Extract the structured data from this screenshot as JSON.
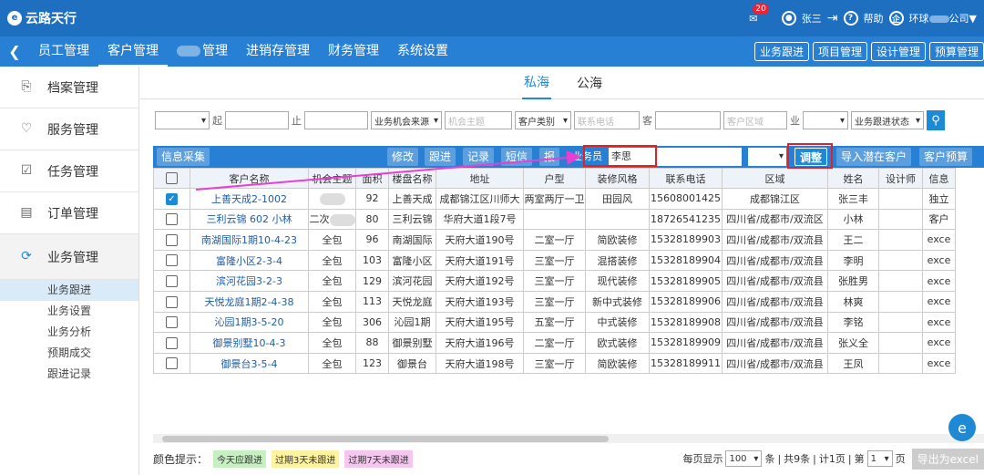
{
  "app": {
    "logo": "云路天行"
  },
  "topbar": {
    "badge_count": "20",
    "user": "张三",
    "help": "帮助",
    "company": "环球",
    "company_suffix": "公司▼"
  },
  "nav": {
    "items": [
      "员工管理",
      "客户管理",
      "管理",
      "进销存管理",
      "财务管理",
      "系统设置"
    ],
    "right_buttons": [
      "业务跟进",
      "项目管理",
      "设计管理",
      "预算管理"
    ]
  },
  "sidebar": {
    "items": [
      "档案管理",
      "服务管理",
      "任务管理",
      "订单管理",
      "业务管理"
    ],
    "sub_items": [
      "业务跟进",
      "业务设置",
      "业务分析",
      "预期成交",
      "跟进记录"
    ]
  },
  "tabs": [
    "私海",
    "公海"
  ],
  "filter": {
    "from": "起",
    "to": "止",
    "source": "业务机会来源",
    "topic_ph": "机会主题",
    "cust_type": "客户类别",
    "phone_ph": "联系电话",
    "cust": "客",
    "region_ph": "客户区域",
    "industry": "业",
    "status": "业务跟进状态"
  },
  "actions": {
    "collect": "信息采集",
    "edit": "修改",
    "follow": "跟进",
    "record": "记录",
    "sms": "短信",
    "report": "报",
    "staff_label": "业务员",
    "staff_value": "李思",
    "adjust": "调整",
    "import": "导入潜在客户",
    "budget": "客户预算"
  },
  "table": {
    "headers": [
      "客户名称",
      "机会主题",
      "面积",
      "楼盘名称",
      "地址",
      "户型",
      "装修风格",
      "联系电话",
      "区域",
      "姓名",
      "设计师",
      "信息"
    ],
    "rows": [
      [
        "上善天成2-1002",
        "",
        "92",
        "上善天成",
        "成都锦江区川师大",
        "两室两厅一卫",
        "田园风",
        "15608001425",
        "成都锦江区",
        "张三丰",
        "",
        "独立"
      ],
      [
        "三利云锦 602 小林",
        "二次",
        "80",
        "三利云锦",
        "华府大道1段7号",
        "",
        "",
        "18726541235",
        "四川省/成都市/双流区",
        "小林",
        "",
        "客户"
      ],
      [
        "南湖国际1期10-4-23",
        "全包",
        "96",
        "南湖国际",
        "天府大道190号",
        "二室一厅",
        "简欧装修",
        "15328189903",
        "四川省/成都市/双流县",
        "王二",
        "",
        "exce"
      ],
      [
        "富隆小区2-3-4",
        "全包",
        "103",
        "富隆小区",
        "天府大道191号",
        "三室一厅",
        "混搭装修",
        "15328189904",
        "四川省/成都市/双流县",
        "李明",
        "",
        "exce"
      ],
      [
        "滨河花园3-2-3",
        "全包",
        "129",
        "滨河花园",
        "天府大道192号",
        "三室一厅",
        "现代装修",
        "15328189905",
        "四川省/成都市/双流县",
        "张胜男",
        "",
        "exce"
      ],
      [
        "天悦龙庭1期2-4-38",
        "全包",
        "113",
        "天悦龙庭",
        "天府大道193号",
        "三室一厅",
        "新中式装修",
        "15328189906",
        "四川省/成都市/双流县",
        "林爽",
        "",
        "exce"
      ],
      [
        "沁园1期3-5-20",
        "全包",
        "306",
        "沁园1期",
        "天府大道195号",
        "五室一厅",
        "中式装修",
        "15328189908",
        "四川省/成都市/双流县",
        "李铭",
        "",
        "exce"
      ],
      [
        "御景别墅10-4-3",
        "全包",
        "88",
        "御景别墅",
        "天府大道196号",
        "二室一厅",
        "欧式装修",
        "15328189909",
        "四川省/成都市/双流县",
        "张义全",
        "",
        "exce"
      ],
      [
        "御景台3-5-4",
        "全包",
        "123",
        "御景台",
        "天府大道198号",
        "三室一厅",
        "简欧装修",
        "15328189911",
        "四川省/成都市/双流县",
        "王凤",
        "",
        "exce"
      ]
    ],
    "checked": [
      true,
      false,
      false,
      false,
      false,
      false,
      false,
      false,
      false
    ]
  },
  "footer": {
    "legend_label": "颜色提示：",
    "tag_today": "今天应跟进",
    "tag_3d": "过期3天未跟进",
    "tag_7d": "过期7天未跟进",
    "per_page": "每页显示",
    "per_page_value": "100",
    "unit": "条",
    "total": "共9条",
    "pages": "计1页",
    "page_prefix": "第",
    "page_value": "1",
    "page_suffix": "页",
    "export": "导出为excel"
  },
  "colors": {
    "primary": "#1e6fbf",
    "nav": "#2780d4",
    "highlight": "#e02222",
    "arrow": "#e83fd0",
    "tag_today": "#c6f0c0",
    "tag_3d": "#fff3a0",
    "tag_7d": "#f5c6f0"
  }
}
